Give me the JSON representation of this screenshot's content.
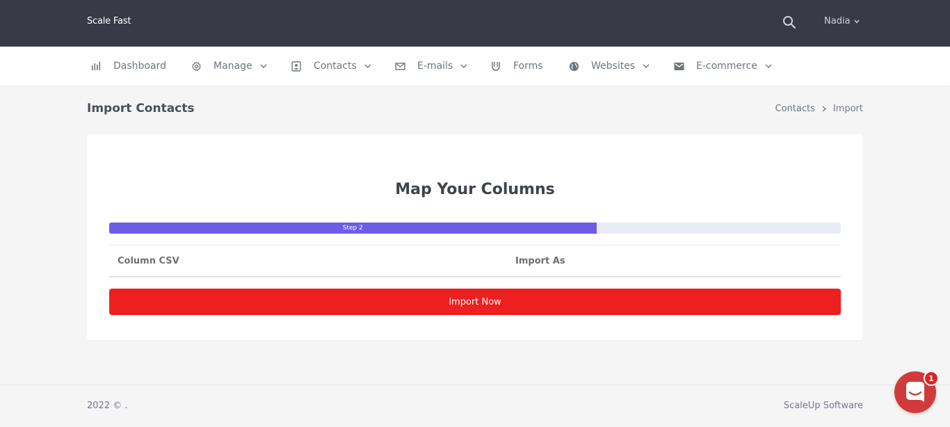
{
  "topbar": {
    "brand": "Scale Fast",
    "user_name": "Nadia"
  },
  "nav": {
    "items": [
      {
        "label": "Dashboard",
        "icon": "bar-chart-icon",
        "has_dropdown": false
      },
      {
        "label": "Manage",
        "icon": "gear-icon",
        "has_dropdown": true
      },
      {
        "label": "Contacts",
        "icon": "contact-card-icon",
        "has_dropdown": true
      },
      {
        "label": "E-mails",
        "icon": "envelope-icon",
        "has_dropdown": true
      },
      {
        "label": "Forms",
        "icon": "magnet-icon",
        "has_dropdown": false
      },
      {
        "label": "Websites",
        "icon": "globe-icon",
        "has_dropdown": true
      },
      {
        "label": "E-commerce",
        "icon": "mail-box-icon",
        "has_dropdown": true
      }
    ]
  },
  "page": {
    "title": "Import Contacts",
    "breadcrumb": [
      "Contacts",
      "Import"
    ]
  },
  "card": {
    "title": "Map Your Columns",
    "progress_label": "Step 2",
    "progress_percent": 66.6,
    "columns": [
      "Column CSV",
      "Import As"
    ],
    "submit_label": "Import Now"
  },
  "footer": {
    "left": "2022 © .",
    "right": "ScaleUp Software"
  },
  "chat": {
    "badge_count": "1"
  },
  "colors": {
    "topbar": "#383a45",
    "progress": "#6c5ce7",
    "button": "#ee1f1f",
    "chat": "#d13a3a"
  }
}
